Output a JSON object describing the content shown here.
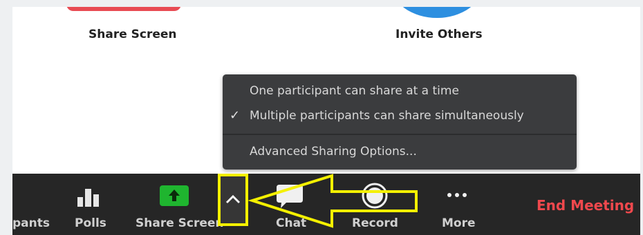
{
  "top": {
    "share_screen_label": "Share Screen",
    "invite_others_label": "Invite Others"
  },
  "menu": {
    "items": [
      {
        "label": "One participant can share at a time",
        "checked": false
      },
      {
        "label": "Multiple participants can share simultaneously",
        "checked": true
      },
      {
        "label": "Advanced Sharing Options...",
        "checked": false
      }
    ],
    "check_glyph": "✓"
  },
  "toolbar": {
    "participants_label": "pants",
    "polls_label": "Polls",
    "share_screen_label": "Share Screen",
    "chat_label": "Chat",
    "record_label": "Record",
    "more_label": "More",
    "end_meeting_label": "End Meeting"
  },
  "colors": {
    "share_green": "#1fb52f",
    "end_meeting_red": "#f0484d",
    "annotation_yellow": "#f4f000",
    "toolbar_bg": "#262626",
    "menu_bg": "#3b3c3e"
  },
  "icons": {
    "polls": "bar-chart-icon",
    "share": "share-up-arrow-icon",
    "caret": "chevron-up-icon",
    "chat": "chat-bubble-icon",
    "record": "record-circle-icon",
    "more": "more-dots-icon"
  }
}
